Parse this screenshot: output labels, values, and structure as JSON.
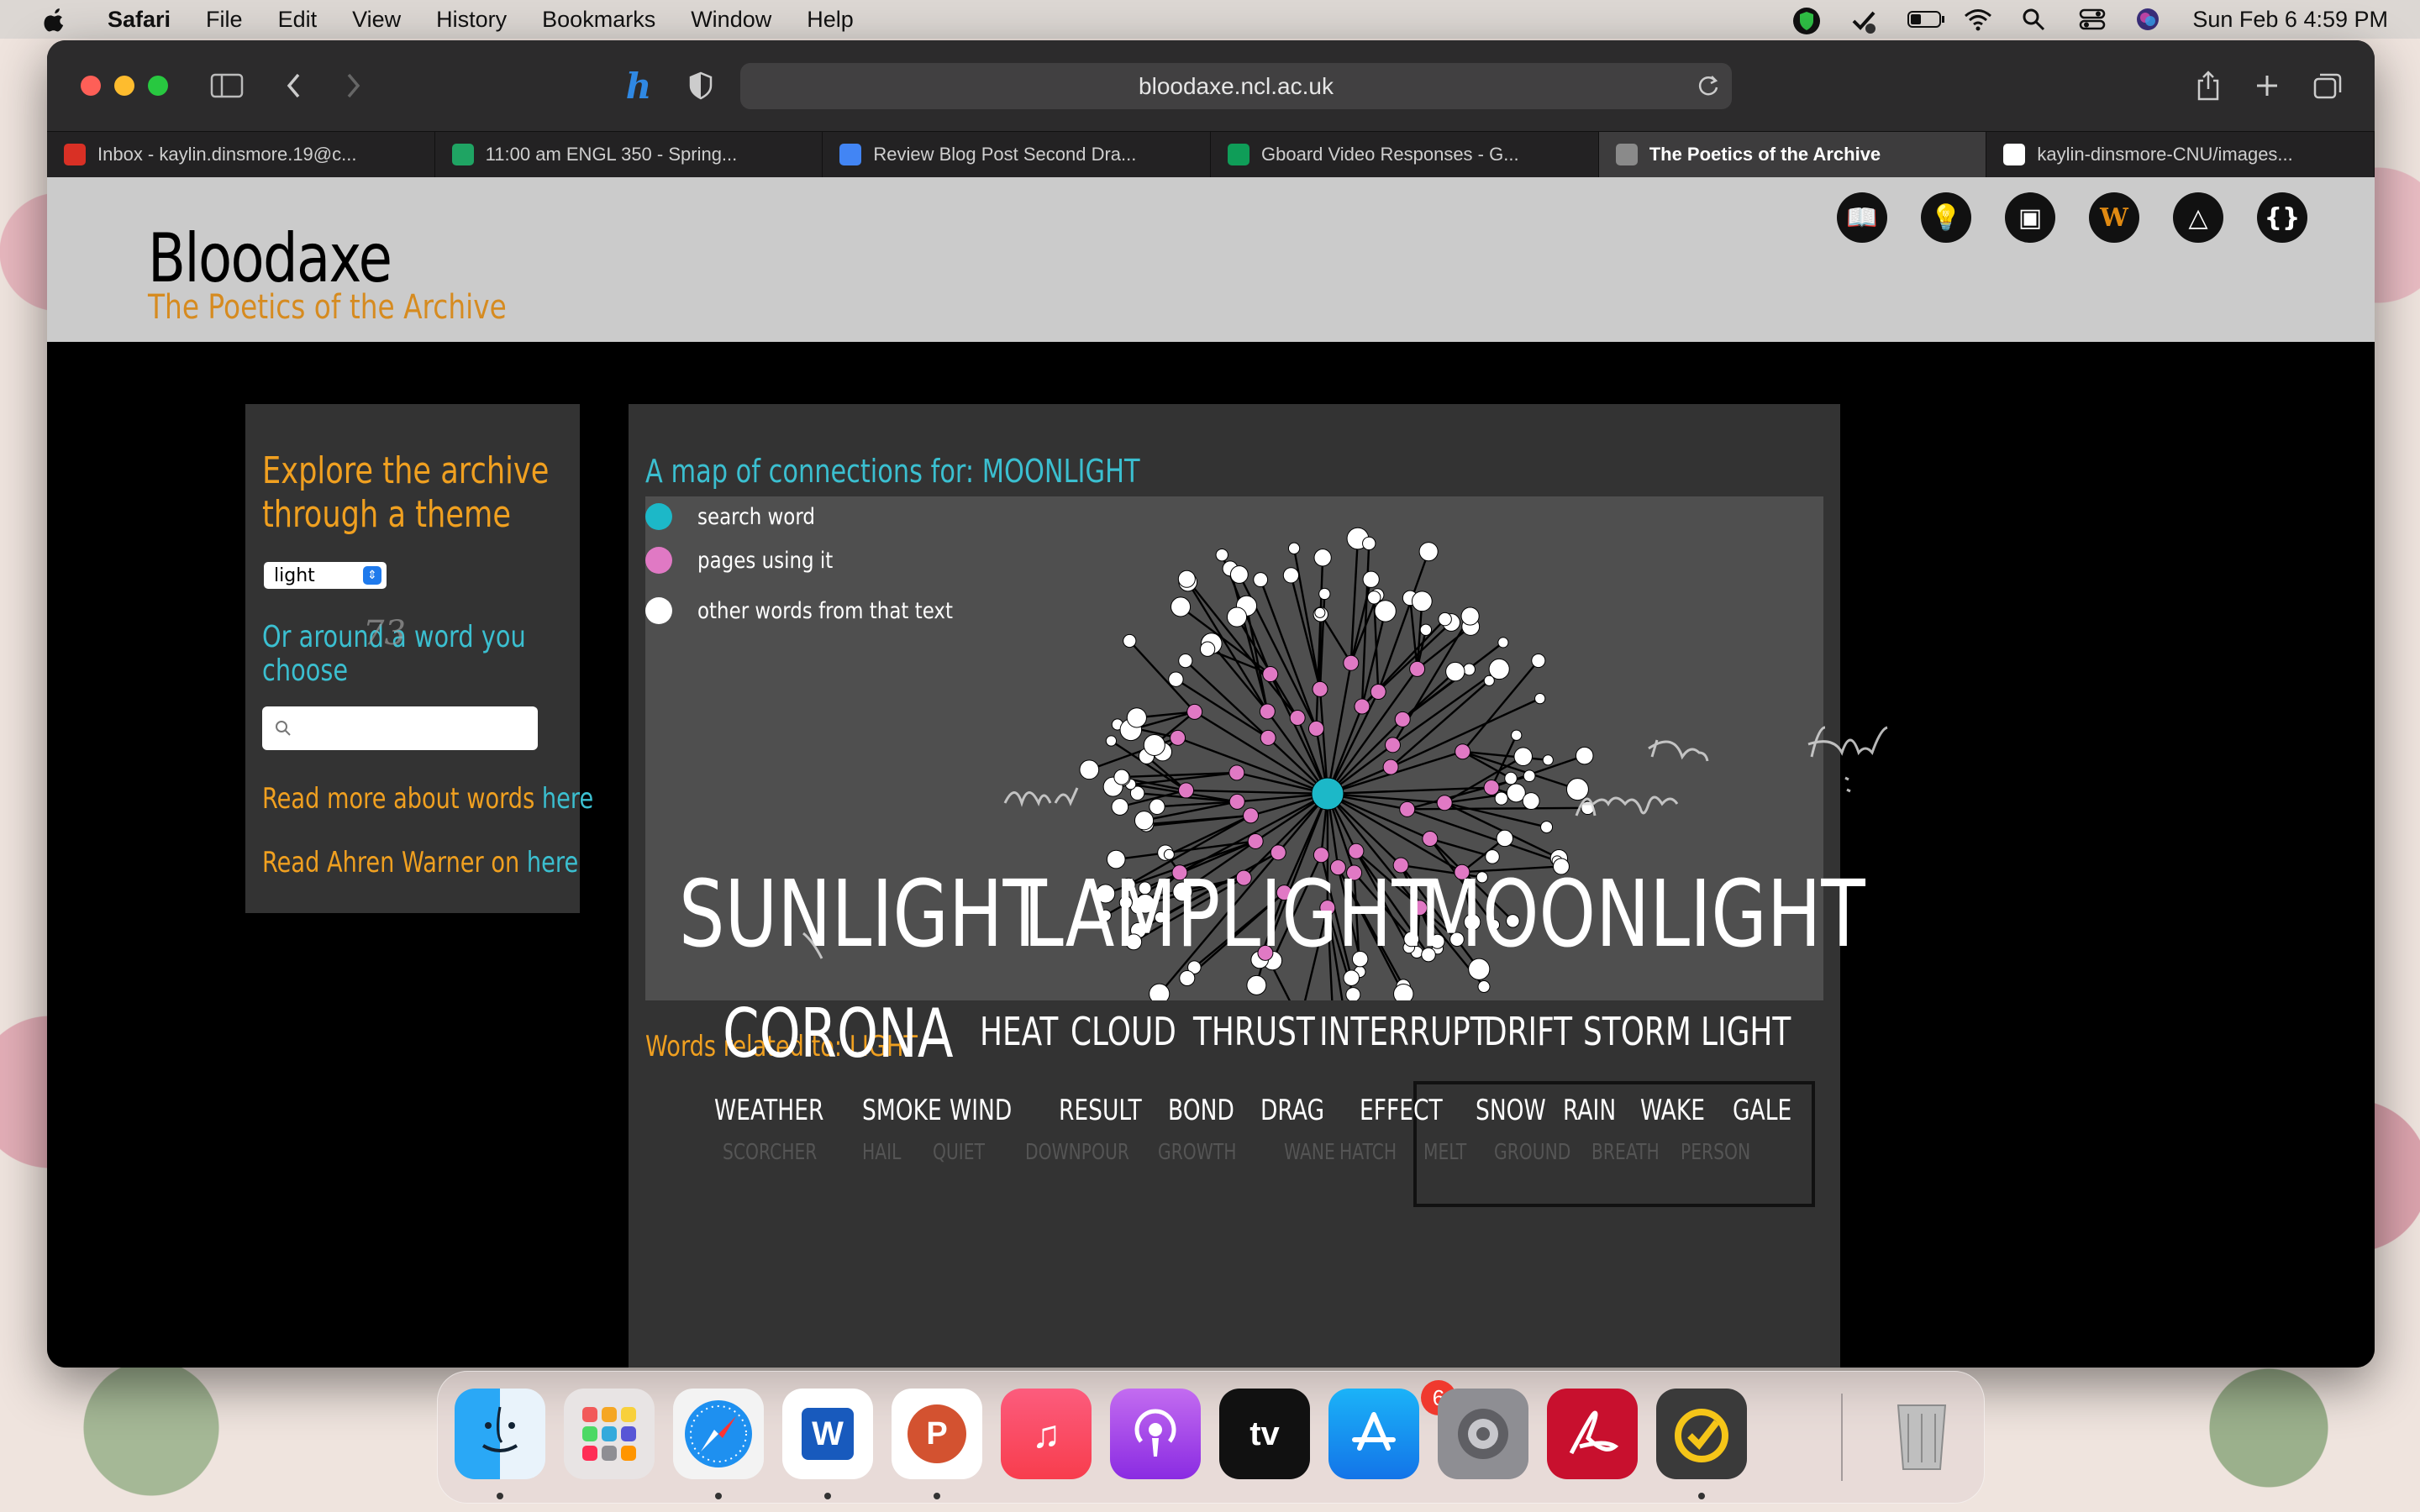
{
  "menubar": {
    "items": [
      "Safari",
      "File",
      "Edit",
      "View",
      "History",
      "Bookmarks",
      "Window",
      "Help"
    ],
    "clock": "Sun Feb 6  4:59 PM"
  },
  "browser": {
    "url": "bloodaxe.ncl.ac.uk",
    "tabs": [
      {
        "title": "Inbox - kaylin.dinsmore.19@c...",
        "icon": "gmail-icon",
        "color": "#d93025"
      },
      {
        "title": "11:00 am ENGL 350 - Spring...",
        "icon": "google-drive-icon",
        "color": "#1fa463"
      },
      {
        "title": "Review Blog Post Second Dra...",
        "icon": "google-docs-icon",
        "color": "#4285f4"
      },
      {
        "title": "Gboard Video Responses - G...",
        "icon": "google-sheets-icon",
        "color": "#0f9d58"
      },
      {
        "title": "The Poetics of the Archive",
        "icon": "notion-icon",
        "color": "#8a8a8a",
        "active": true
      },
      {
        "title": "kaylin-dinsmore-CNU/images...",
        "icon": "github-icon",
        "color": "#ffffff"
      }
    ]
  },
  "site": {
    "title": "Bloodaxe",
    "subtitle": "The Poetics of the Archive",
    "header_icons": [
      "book-icon",
      "lightbulb-icon",
      "reader-icon",
      "w-icon",
      "triangle-icon",
      "braces-icon"
    ],
    "header_icon_glyphs": [
      "📖",
      "💡",
      "▣",
      "W",
      "△",
      "{}"
    ]
  },
  "sidebar": {
    "heading_line1": "Explore the archive",
    "heading_line2": "through a theme",
    "theme_value": "light",
    "word_prompt_line1": "Or around a word you",
    "word_prompt_line2": "choose",
    "search_value": "",
    "more_words_prefix": "Read more about words ",
    "more_words_link": "here",
    "warner_prefix": "Read Ahren Warner on ",
    "warner_link": "here"
  },
  "map": {
    "title": "A map of connections for: MOONLIGHT",
    "legend": [
      {
        "label": "search word",
        "color": "#1cb8c8"
      },
      {
        "label": "pages using it",
        "color": "#e079c4"
      },
      {
        "label": "other words from that text",
        "color": "#ffffff"
      }
    ],
    "overlay_scribbles": [
      "Year",
      "behind",
      "Asylum"
    ]
  },
  "related": {
    "title": "Words related to: LIGHT",
    "row1": [
      "SUNLIGHT",
      "LAMPLIGHT",
      "MOONLIGHT"
    ],
    "row2": [
      "CORONA",
      "HEAT",
      "CLOUD",
      "THRUST",
      "INTERRUPT",
      "DRIFT",
      "STORM",
      "LIGHT"
    ],
    "row3": [
      "WEATHER",
      "SMOKE",
      "WIND",
      "RESULT",
      "BOND",
      "DRAG",
      "EFFECT",
      "SNOW",
      "RAIN",
      "WAKE",
      "GALE"
    ],
    "row4": [
      "SCORCHER",
      "HAIL",
      "QUIET",
      "DOWNPOUR",
      "GROWTH",
      "WANE",
      "HATCH",
      "MELT",
      "GROUND",
      "BREATH",
      "PERSON"
    ],
    "selected": "MOONLIGHT"
  },
  "dock": {
    "apps": [
      "finder-icon",
      "launchpad-icon",
      "safari-icon",
      "word-icon",
      "powerpoint-icon",
      "music-icon",
      "podcasts-icon",
      "apple-tv-icon",
      "app-store-icon",
      "system-preferences-icon",
      "acrobat-icon",
      "norton-icon",
      "trash-icon"
    ],
    "app_store_badge": "6",
    "tv_label": "tv"
  }
}
